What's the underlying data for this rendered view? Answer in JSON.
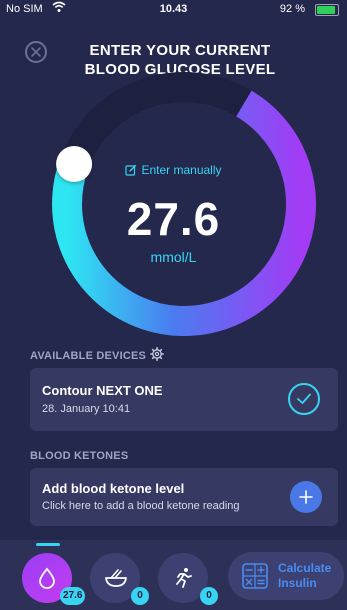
{
  "status_bar": {
    "carrier": "No SIM",
    "time": "10.43",
    "battery": "92 %"
  },
  "header": {
    "title_line1": "ENTER YOUR CURRENT",
    "title_line2": "BLOOD GLUCOSE LEVEL"
  },
  "reading": {
    "enter_manually": "Enter manually",
    "value": "27.6",
    "unit": "mmol/L",
    "dial_level": 0.72
  },
  "devices": {
    "section_label": "AVAILABLE DEVICES",
    "device_name": "Contour NEXT ONE",
    "device_date": "28. January 10:41"
  },
  "ketones": {
    "section_label": "BLOOD KETONES",
    "title": "Add blood ketone level",
    "subtitle": "Click here to add a blood ketone reading"
  },
  "tabbar": {
    "glucose_badge": "27.6",
    "food_badge": "0",
    "activity_badge": "0",
    "calculate_line1": "Calculate",
    "calculate_line2": "Insulin"
  },
  "colors": {
    "background": "#25284d",
    "accent_cyan": "#38d4f2",
    "accent_purple": "#9a3ff5",
    "card": "#363a63"
  }
}
